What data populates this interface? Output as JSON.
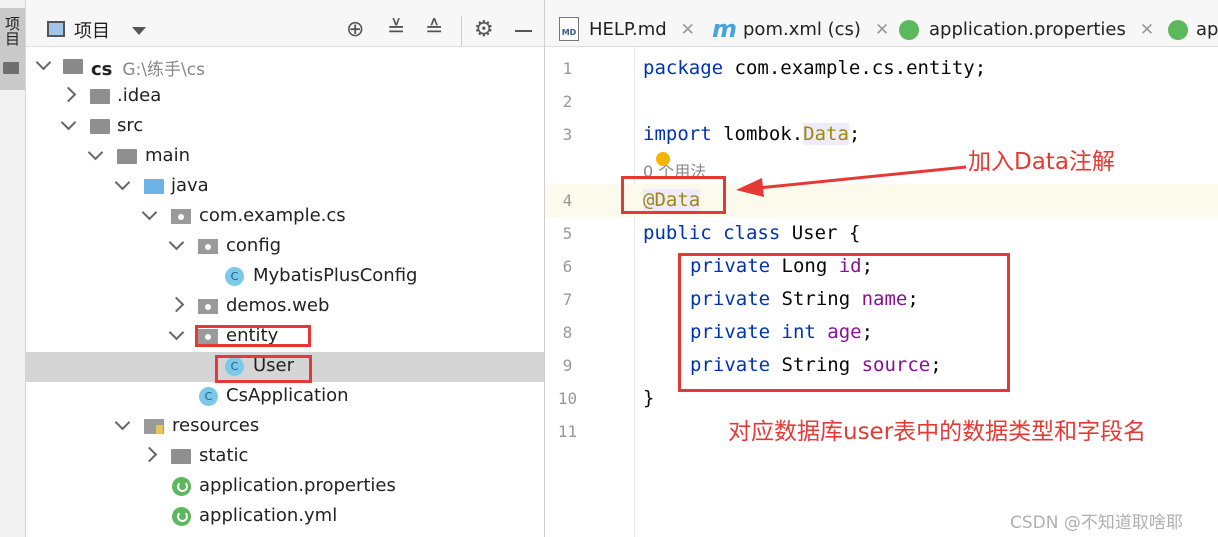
{
  "side_strip": {
    "label": "项目"
  },
  "project_panel": {
    "title": "项目"
  },
  "tree": [
    {
      "label": "cs",
      "path": "G:\\练手\\cs"
    },
    {
      "label": ".idea"
    },
    {
      "label": "src"
    },
    {
      "label": "main"
    },
    {
      "label": "java"
    },
    {
      "label": "com.example.cs"
    },
    {
      "label": "config"
    },
    {
      "label": "MybatisPlusConfig"
    },
    {
      "label": "demos.web"
    },
    {
      "label": "entity"
    },
    {
      "label": "User"
    },
    {
      "label": "CsApplication"
    },
    {
      "label": "resources"
    },
    {
      "label": "static"
    },
    {
      "label": "application.properties"
    },
    {
      "label": "application.yml"
    }
  ],
  "editor": {
    "tabs": [
      {
        "label": "HELP.md",
        "icon": "markdown-icon",
        "icon_text": "MD"
      },
      {
        "label": "pom.xml (cs)",
        "icon": "maven-icon",
        "icon_text": "m"
      },
      {
        "label": "application.properties",
        "icon": "spring-icon"
      },
      {
        "label": "ap",
        "icon": "spring-icon"
      }
    ],
    "line_numbers": [
      "1",
      "2",
      "3",
      "4",
      "5",
      "6",
      "7",
      "8",
      "9",
      "10",
      "11"
    ],
    "usage_hint": "0 个用法",
    "code": {
      "l1_kw": "package",
      "l1_rest": " com.example.cs.entity;",
      "l3_kw": "import",
      "l3_pre": " lombok.",
      "l3_ann": "Data",
      "l3_end": ";",
      "l4": "@Data",
      "l5_kw1": "public",
      "l5_kw2": " class",
      "l5_rest": " User {",
      "l6_kw": "private",
      "l6_type": " Long ",
      "l6_field": "id",
      "l6_end": ";",
      "l7_kw": "private",
      "l7_type": " String ",
      "l7_field": "name",
      "l7_end": ";",
      "l8_kw": "private",
      "l8_type": " int",
      "l8_pad": " ",
      "l8_field": "age",
      "l8_end": ";",
      "l9_kw": "private",
      "l9_type": " String ",
      "l9_field": "source",
      "l9_end": ";",
      "l10": "}"
    }
  },
  "annotations": {
    "add_data_note": "加入Data注解",
    "fields_note": "对应数据库user表中的数据类型和字段名"
  },
  "watermark": "CSDN @不知道取啥耶",
  "colors": {
    "keyword": "#0033b3",
    "field": "#871094",
    "annotation": "#9e880d",
    "highlight_red": "#e53935",
    "selected_row": "#d5d5d5"
  }
}
